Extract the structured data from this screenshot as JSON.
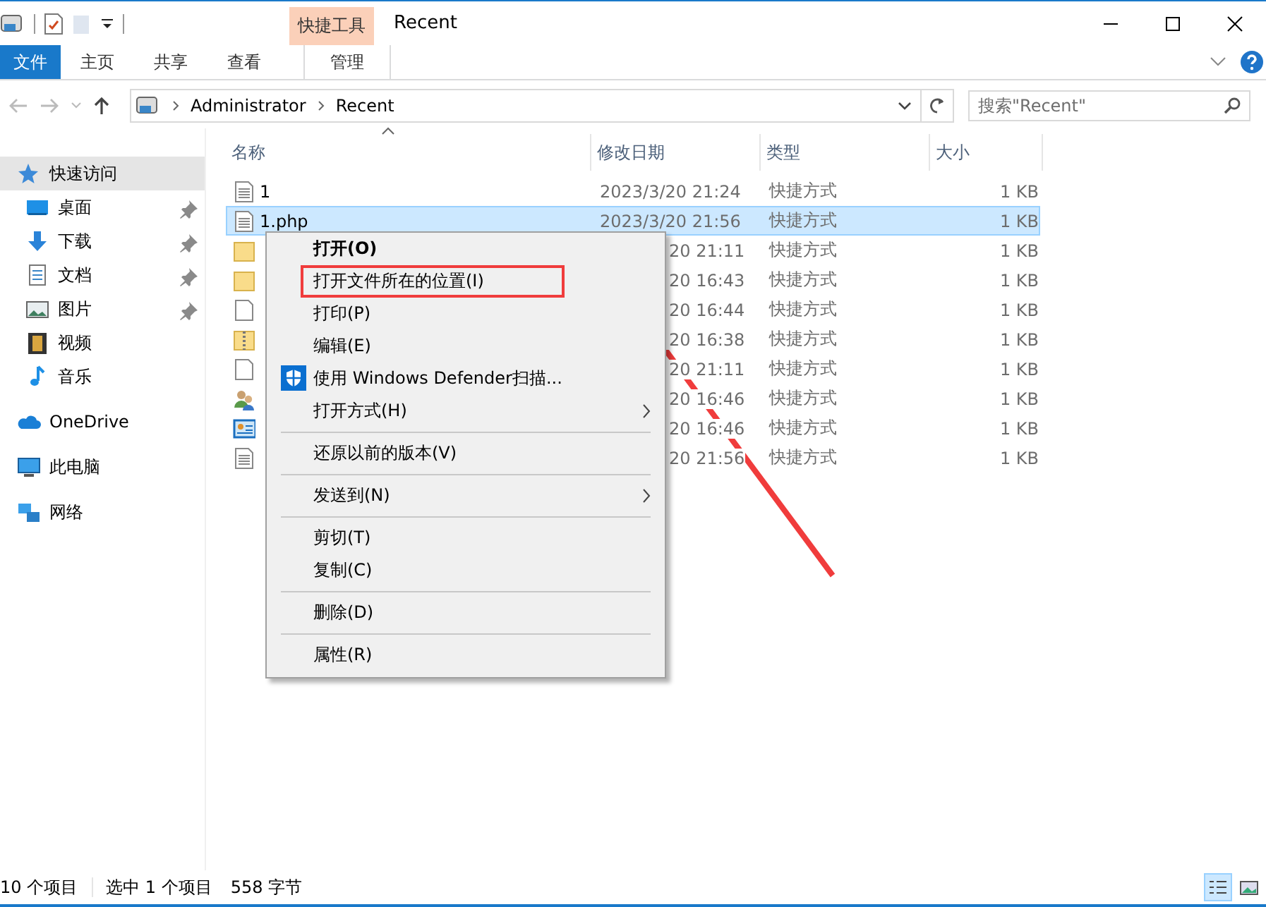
{
  "title_bar": {
    "context_tab": "快捷工具",
    "title": "Recent"
  },
  "ribbon_tabs": [
    {
      "label": "文件",
      "kind": "file"
    },
    {
      "label": "主页",
      "kind": "normal"
    },
    {
      "label": "共享",
      "kind": "normal"
    },
    {
      "label": "查看",
      "kind": "normal"
    },
    {
      "label": "管理",
      "kind": "context"
    }
  ],
  "address_bar": {
    "path": [
      "Administrator",
      "Recent"
    ]
  },
  "search": {
    "placeholder": "搜索\"Recent\""
  },
  "nav_pane": [
    {
      "label": "快速访问",
      "kind": "star",
      "selected": true,
      "pinned": false,
      "children": [
        {
          "label": "桌面",
          "kind": "desktop",
          "selected": false,
          "pinned": true
        },
        {
          "label": "下载",
          "kind": "download",
          "selected": false,
          "pinned": true
        },
        {
          "label": "文档",
          "kind": "document",
          "selected": false,
          "pinned": true
        },
        {
          "label": "图片",
          "kind": "pictures",
          "selected": false,
          "pinned": true
        },
        {
          "label": "视频",
          "kind": "videos",
          "selected": false,
          "pinned": false
        },
        {
          "label": "音乐",
          "kind": "music",
          "selected": false,
          "pinned": false
        }
      ]
    },
    {
      "label": "OneDrive",
      "kind": "cloud",
      "selected": false,
      "pinned": false
    },
    {
      "label": "此电脑",
      "kind": "pc",
      "selected": false,
      "pinned": false
    },
    {
      "label": "网络",
      "kind": "network",
      "selected": false,
      "pinned": false
    }
  ],
  "file_list": {
    "columns": [
      "名称",
      "修改日期",
      "类型",
      "大小"
    ],
    "rows": [
      {
        "kind": "text",
        "name": "1",
        "date": "2023/3/20 21:24",
        "type": "快捷方式",
        "size": "1 KB",
        "selected": false,
        "covered": false
      },
      {
        "kind": "text",
        "name": "1.php",
        "date": "2023/3/20 21:56",
        "type": "快捷方式",
        "size": "1 KB",
        "selected": true,
        "covered": false
      },
      {
        "kind": "folder",
        "date": "20 21:11",
        "type": "快捷方式",
        "size": "1 KB",
        "selected": false,
        "covered": true
      },
      {
        "kind": "folder",
        "date": "20 16:43",
        "type": "快捷方式",
        "size": "1 KB",
        "selected": false,
        "covered": true
      },
      {
        "kind": "blank",
        "date": "20 16:44",
        "type": "快捷方式",
        "size": "1 KB",
        "selected": false,
        "covered": true
      },
      {
        "kind": "zip",
        "date": "20 16:38",
        "type": "快捷方式",
        "size": "1 KB",
        "selected": false,
        "covered": true
      },
      {
        "kind": "blank",
        "date": "20 21:11",
        "type": "快捷方式",
        "size": "1 KB",
        "selected": false,
        "covered": true
      },
      {
        "kind": "people",
        "date": "20 16:46",
        "type": "快捷方式",
        "size": "1 KB",
        "selected": false,
        "covered": true
      },
      {
        "kind": "card",
        "date": "20 16:46",
        "type": "快捷方式",
        "size": "1 KB",
        "selected": false,
        "covered": true
      },
      {
        "kind": "text",
        "date": "20 21:56",
        "type": "快捷方式",
        "size": "1 KB",
        "selected": false,
        "covered": true
      }
    ]
  },
  "context_menu": [
    {
      "kind": "item",
      "label": "打开(O)",
      "bold": true,
      "submenu": false,
      "highlighted": false
    },
    {
      "kind": "item",
      "label": "打开文件所在的位置(I)",
      "bold": false,
      "submenu": false,
      "highlighted": true
    },
    {
      "kind": "item",
      "label": "打印(P)",
      "bold": false,
      "submenu": false,
      "highlighted": false
    },
    {
      "kind": "item",
      "label": "编辑(E)",
      "bold": false,
      "submenu": false,
      "highlighted": false
    },
    {
      "kind": "defender",
      "label": "使用 Windows Defender扫描...",
      "bold": false,
      "submenu": false,
      "highlighted": false
    },
    {
      "kind": "item",
      "label": "打开方式(H)",
      "bold": false,
      "submenu": true,
      "highlighted": false
    },
    {
      "kind": "separator"
    },
    {
      "kind": "item",
      "label": "还原以前的版本(V)",
      "bold": false,
      "submenu": false,
      "highlighted": false
    },
    {
      "kind": "separator"
    },
    {
      "kind": "item",
      "label": "发送到(N)",
      "bold": false,
      "submenu": true,
      "highlighted": false
    },
    {
      "kind": "separator"
    },
    {
      "kind": "item",
      "label": "剪切(T)",
      "bold": false,
      "submenu": false,
      "highlighted": false
    },
    {
      "kind": "item",
      "label": "复制(C)",
      "bold": false,
      "submenu": false,
      "highlighted": false
    },
    {
      "kind": "separator"
    },
    {
      "kind": "item",
      "label": "删除(D)",
      "bold": false,
      "submenu": false,
      "highlighted": false
    },
    {
      "kind": "separator"
    },
    {
      "kind": "item",
      "label": "属性(R)",
      "bold": false,
      "submenu": false,
      "highlighted": false
    }
  ],
  "callout_arrow": true,
  "status_bar": {
    "items": [
      "10 个项目",
      "选中 1 个项目",
      "558 字节"
    ],
    "views": [
      {
        "kind": "details",
        "selected": true
      },
      {
        "kind": "large",
        "selected": false
      }
    ]
  }
}
